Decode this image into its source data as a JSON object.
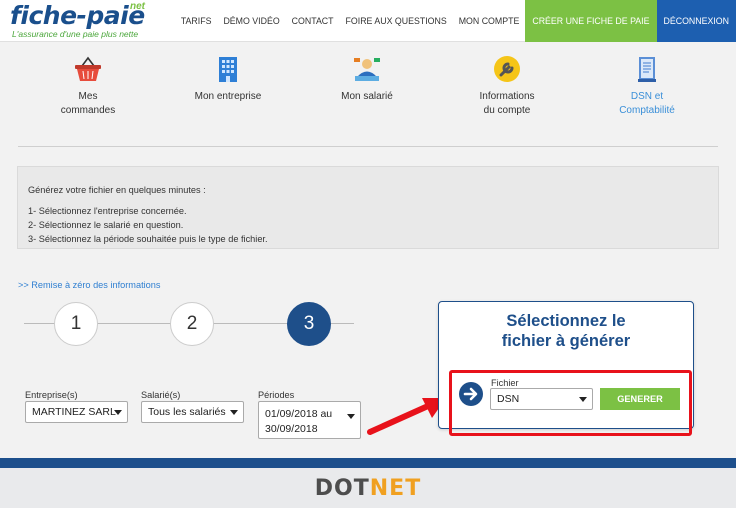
{
  "header": {
    "logo_main": "fiche-paie",
    "logo_net": "net",
    "logo_tagline": "L'assurance d'une paie plus nette",
    "nav": [
      {
        "label": "TARIFS"
      },
      {
        "label": "DÉMO VIDÉO"
      },
      {
        "label": "CONTACT"
      },
      {
        "label": "FOIRE AUX QUESTIONS"
      },
      {
        "label": "MON COMPTE"
      }
    ],
    "create_label": "CRÉER UNE FICHE DE PAIE",
    "logout_label": "DÉCONNEXION",
    "colors": {
      "create": "#7cc144",
      "logout": "#1d5fb0"
    }
  },
  "menu": {
    "items": [
      {
        "icon": "basket-icon",
        "line1": "Mes",
        "line2": "commandes"
      },
      {
        "icon": "building-icon",
        "line1": "Mon entreprise",
        "line2": ""
      },
      {
        "icon": "employee-icon",
        "line1": "Mon salarié",
        "line2": ""
      },
      {
        "icon": "wrench-icon",
        "line1": "Informations",
        "line2": "du compte"
      },
      {
        "icon": "document-icon",
        "line1": "DSN et",
        "line2": "Comptabilité",
        "active": true
      }
    ]
  },
  "instructions": {
    "intro": "Générez votre fichier en quelques minutes :",
    "step1": "1- Sélectionnez l'entreprise concernée.",
    "step2": "2- Sélectionnez le salarié en question.",
    "step3": "3- Sélectionnez la période souhaitée puis le type de fichier."
  },
  "reset_link": ">> Remise à zéro des informations",
  "steps": [
    "1",
    "2",
    "3"
  ],
  "current_step": 3,
  "form": {
    "entreprise_label": "Entreprise(s)",
    "entreprise_value": "MARTINEZ SARL",
    "salarie_label": "Salarié(s)",
    "salarie_value": "Tous les salariés",
    "periode_label": "Périodes",
    "periode_line1": "01/09/2018 au",
    "periode_line2": "30/09/2018"
  },
  "panel": {
    "title_line1": "Sélectionnez le",
    "title_line2": "fichier à générer",
    "fichier_label": "Fichier",
    "fichier_value": "DSN",
    "generate_label": "GENERER"
  },
  "watermark": {
    "part1": "DOT",
    "part2": "NET"
  }
}
